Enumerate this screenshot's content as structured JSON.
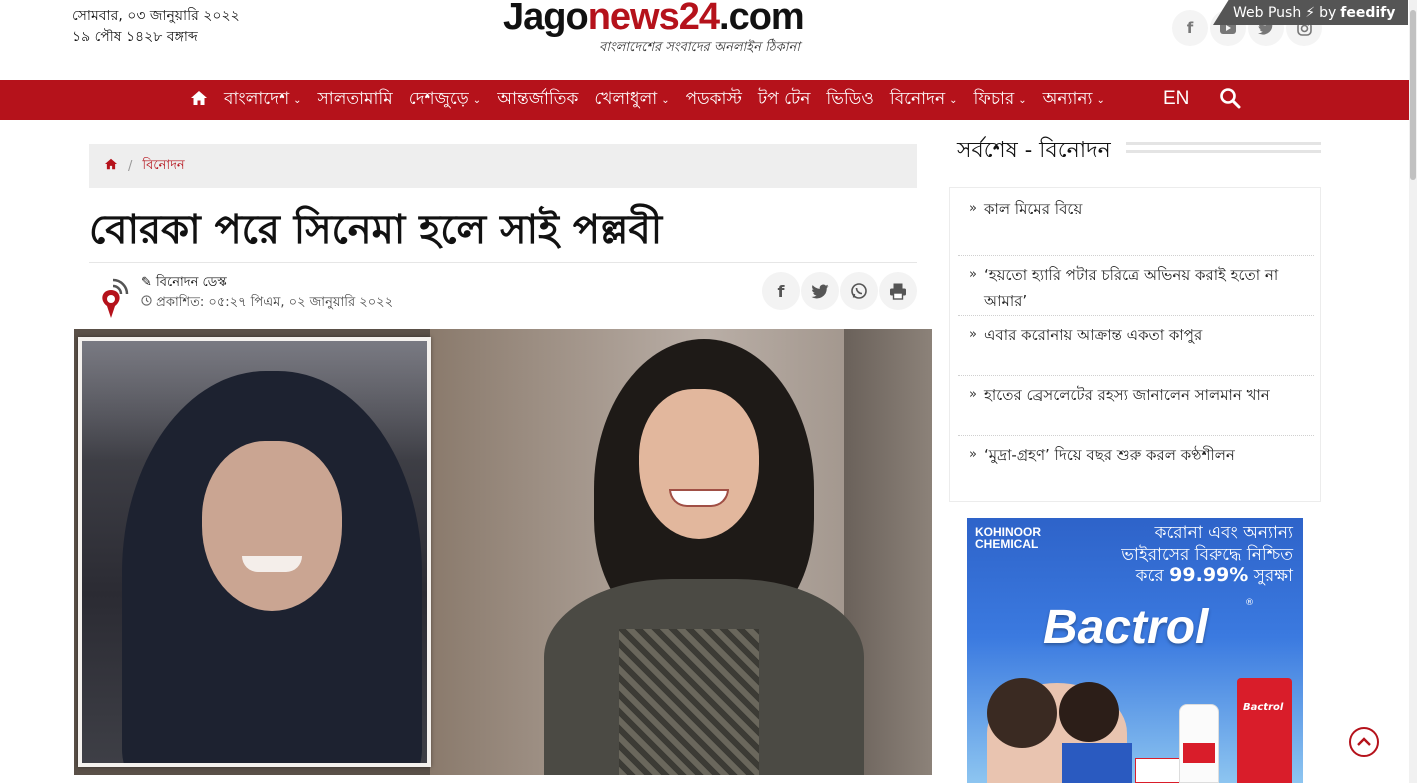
{
  "header": {
    "date_bn": "সোমবার, ০৩ জানুয়ারি ২০২২",
    "date_bangla": "১৯ পৌষ ১৪২৮ বঙ্গাব্দ",
    "logo_text_a": "Jago",
    "logo_text_b": "news24",
    "logo_text_c": ".com",
    "logo_tagline": "বাংলাদেশের সংবাদের অনলাইন ঠিকানা",
    "social_icons": [
      "facebook-icon",
      "youtube-icon",
      "twitter-icon",
      "instagram-icon"
    ],
    "webpush_label": "Web Push",
    "webpush_by": "by",
    "webpush_brand": "feedify"
  },
  "nav": {
    "items": [
      {
        "label": "বাংলাদেশ",
        "dropdown": true
      },
      {
        "label": "সালতামামি",
        "dropdown": false
      },
      {
        "label": "দেশজুড়ে",
        "dropdown": true
      },
      {
        "label": "আন্তর্জাতিক",
        "dropdown": false
      },
      {
        "label": "খেলাধুলা",
        "dropdown": true
      },
      {
        "label": "পডকাস্ট",
        "dropdown": false
      },
      {
        "label": "টপ টেন",
        "dropdown": false
      },
      {
        "label": "ভিডিও",
        "dropdown": false
      },
      {
        "label": "বিনোদন",
        "dropdown": true
      },
      {
        "label": "ফিচার",
        "dropdown": true
      },
      {
        "label": "অন্যান্য",
        "dropdown": true
      }
    ],
    "lang": "EN",
    "caret": "⌄"
  },
  "breadcrumb": {
    "category": "বিনোদন"
  },
  "article": {
    "title": "বোরকা পরে সিনেমা হলে সাই পল্লবী",
    "author": "বিনোদন ডেস্ক",
    "published_label": "প্রকাশিত:",
    "published_time": "০৫:২৭ পিএম, ০২ জানুয়ারি ২০২২",
    "share_icons": [
      "facebook-share-icon",
      "twitter-share-icon",
      "whatsapp-share-icon",
      "print-icon"
    ]
  },
  "sidebar": {
    "title": "সর্বশেষ - বিনোদন",
    "items": [
      {
        "text": "কাল মিমের বিয়ে"
      },
      {
        "text": "‘হয়তো হ্যারি পটার চরিত্রে অভিনয় করাই হতো না আমার’"
      },
      {
        "text": "এবার করোনায় আক্রান্ত একতা কাপুর"
      },
      {
        "text": "হাতের ব্রেসলেটের রহস্য জানালেন সালমান খান"
      },
      {
        "text": "‘মুদ্রা-গ্রহণ’ দিয়ে বছর শুরু করল কণ্ঠশীলন"
      }
    ]
  },
  "ad": {
    "company": "KOHINOOR CHEMICAL",
    "line1": "করোনা এবং অন্যান্য",
    "line2": "ভাইরাসের বিরুদ্ধে নিশ্চিত",
    "line3a": "করে",
    "line3b": "99.99%",
    "line3c": "সুরক্ষা",
    "brand": "Bactrol",
    "pack_label": "Bactrol"
  },
  "colors": {
    "brand_red": "#b5121b",
    "nav_text": "#ffffff",
    "breadcrumb_bg": "#eeeeee"
  }
}
